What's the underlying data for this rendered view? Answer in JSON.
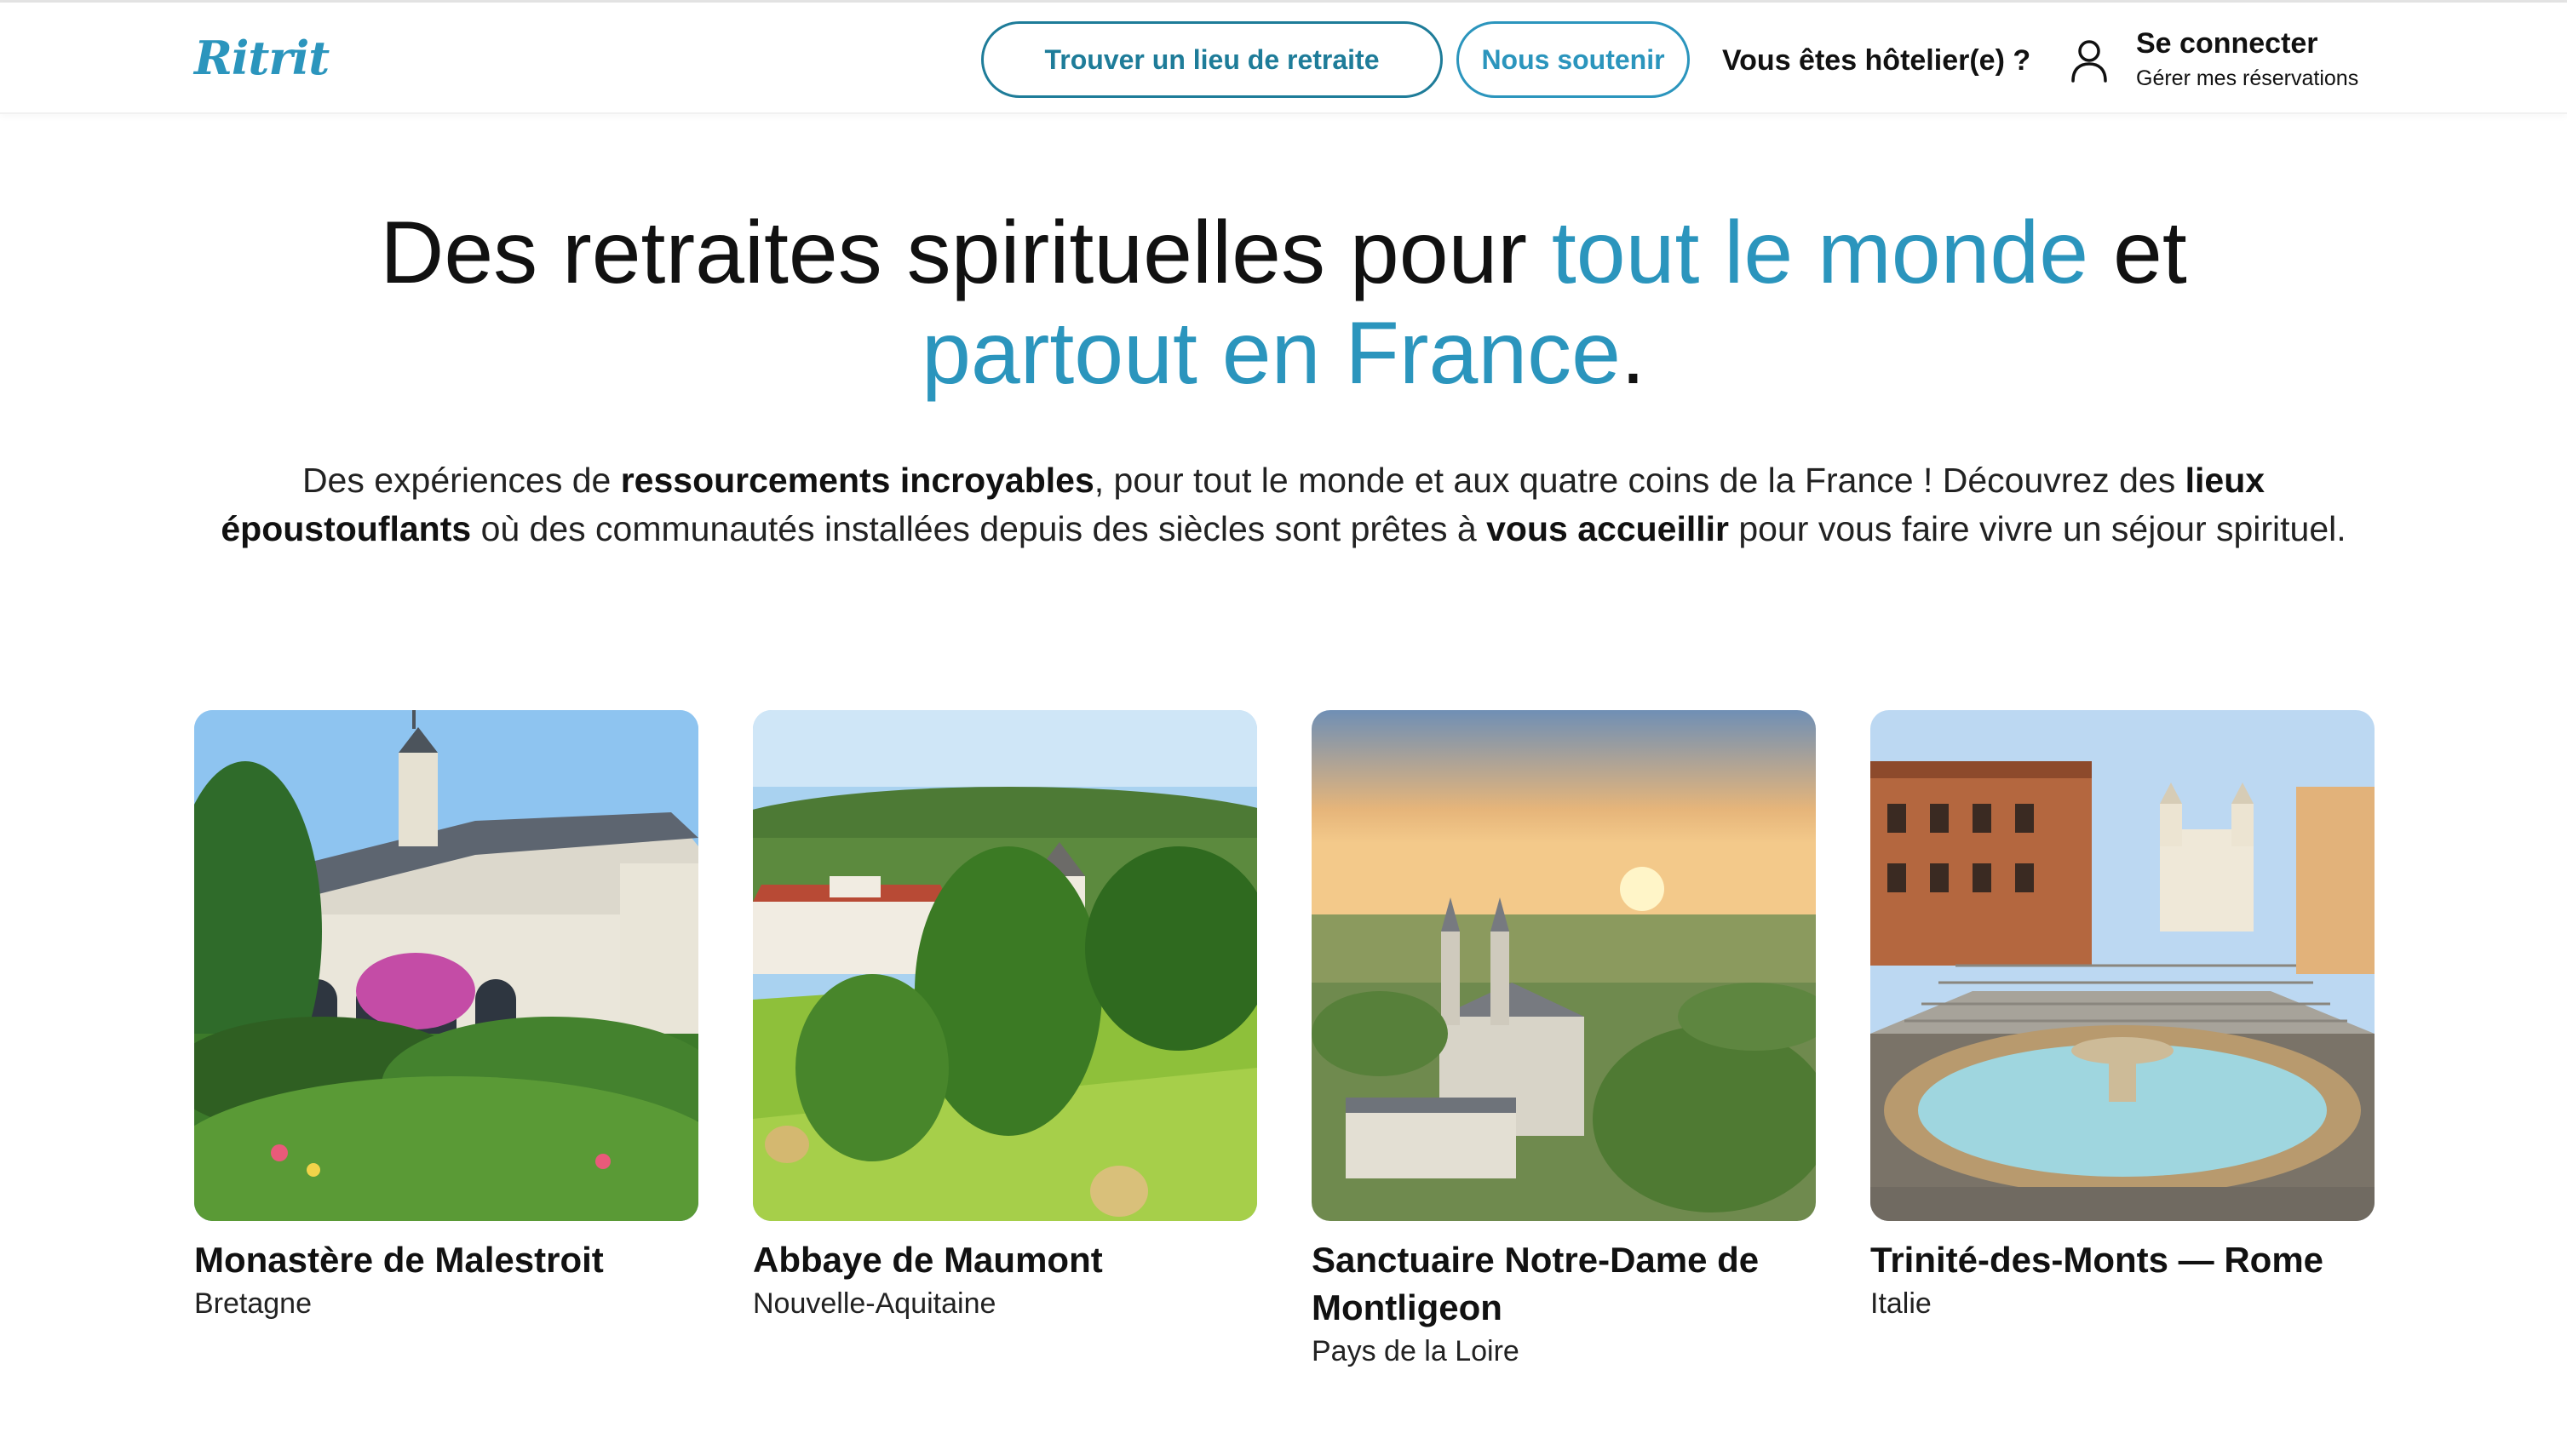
{
  "header": {
    "logo": "Ritrit",
    "find_button": "Trouver un lieu de retraite",
    "support_button": "Nous soutenir",
    "hotelier_link": "Vous êtes hôtelier(e) ?",
    "login_title": "Se connecter",
    "login_sub": "Gérer mes réservations",
    "user_icon": "user-icon"
  },
  "hero": {
    "title_1": "Des retraites spirituelles pour ",
    "title_2": "tout le monde",
    "title_3": " et",
    "title_4": "partout en France",
    "title_5": ".",
    "desc_1": "Des expériences de ",
    "desc_2": "ressourcements incroyables",
    "desc_3": ", pour tout le monde et aux quatre coins de la France ! Découvrez des ",
    "desc_4": "lieux époustouflants",
    "desc_5": " où des communautés installées depuis des siècles sont prêtes à ",
    "desc_6": "vous accueillir",
    "desc_7": " pour vous faire vivre un séjour spirituel."
  },
  "cards": [
    {
      "title": "Monastère de Malestroit",
      "region": "Bretagne"
    },
    {
      "title": "Abbaye de Maumont",
      "region": "Nouvelle-Aquitaine"
    },
    {
      "title": "Sanctuaire Notre-Dame de Montligeon",
      "region": "Pays de la Loire"
    },
    {
      "title": "Trinité-des-Monts — Rome",
      "region": "Italie"
    }
  ],
  "colors": {
    "accent": "#2b95bd",
    "button_border": "#1e7c99",
    "text": "#111111"
  }
}
